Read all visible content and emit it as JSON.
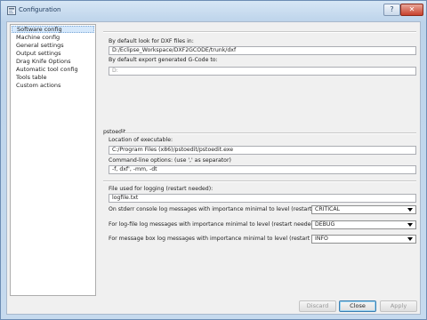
{
  "window": {
    "title": "Configuration",
    "help_label": "?",
    "close_label": "✕"
  },
  "sidebar": {
    "items": [
      {
        "label": "Software config",
        "selected": true
      },
      {
        "label": "Machine config"
      },
      {
        "label": "General settings"
      },
      {
        "label": "Output settings"
      },
      {
        "label": "Drag Knife Options"
      },
      {
        "label": "Automatic tool config"
      },
      {
        "label": "Tools table"
      },
      {
        "label": "Custom actions"
      }
    ]
  },
  "paths": {
    "dxf_label": "By default look for DXF files in:",
    "dxf_value": "D:/Eclipse_Workspace/DXF2GCODE/trunk/dxf",
    "gcode_label": "By default export generated G-Code to:",
    "gcode_value": "D:"
  },
  "pstoedit": {
    "section_label": "pstoedit",
    "exe_label": "Location of executable:",
    "exe_value": "C:/Program Files (x86)/pstoedit/pstoedit.exe",
    "opts_label": "Command-line options: (use ',' as separator)",
    "opts_value": "-f, dxf', -mm, -dt"
  },
  "logging": {
    "file_label": "File used for logging (restart needed):",
    "file_value": "logfile.txt",
    "stderr_label": "On stderr console log messages with importance minimal to level (restart needed):",
    "stderr_value": "CRITICAL",
    "logfile_label": "For log-file log messages with importance minimal to level (restart needed):",
    "logfile_value": "DEBUG",
    "msgbox_label": "For message box log messages with importance minimal to level (restart needed):",
    "msgbox_value": "INFO"
  },
  "buttons": {
    "discard": "Discard",
    "close": "Close",
    "apply": "Apply"
  }
}
